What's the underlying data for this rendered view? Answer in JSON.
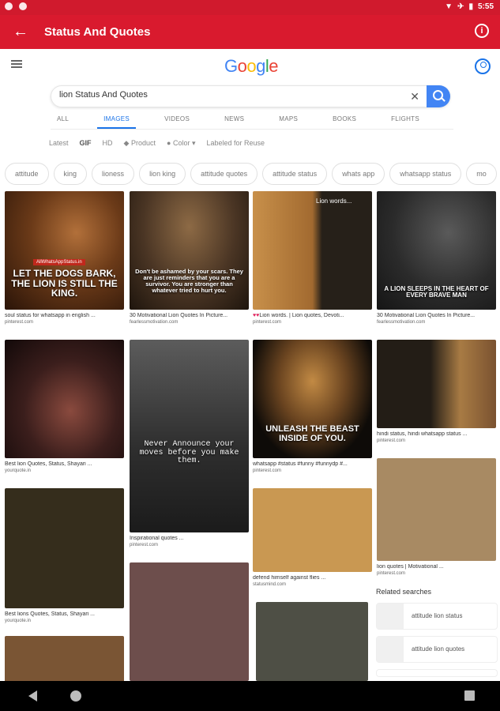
{
  "status_bar": {
    "time": "5:55"
  },
  "app_bar": {
    "title": "Status And Quotes"
  },
  "google": {
    "logo_letters": [
      "G",
      "o",
      "o",
      "g",
      "l",
      "e"
    ]
  },
  "search": {
    "query": "lion Status And Quotes"
  },
  "tabs": [
    "ALL",
    "IMAGES",
    "VIDEOS",
    "NEWS",
    "MAPS",
    "BOOKS",
    "FLIGHTS"
  ],
  "tools": [
    "Latest",
    "GIF",
    "HD",
    "Product",
    "Color",
    "Labeled for Reuse"
  ],
  "chips": [
    "attitude",
    "king",
    "lioness",
    "lion king",
    "attitude quotes",
    "attitude status",
    "whats app",
    "whatsapp status",
    "mo"
  ],
  "results": [
    {
      "caption": "soul status for whatsapp in english ...",
      "source": "pinterest.com",
      "overlay": "LET THE DOGS BARK, THE LION IS STILL THE KING.",
      "banner": "AllWhatsAppStatus.in"
    },
    {
      "caption": "30 Motivational Lion Quotes In Picture...",
      "source": "fearlessmotivation.com",
      "overlay": "Don't be ashamed by your scars. They are just reminders that you are a survivor. You are stronger than whatever tried to hurt you."
    },
    {
      "caption": "Lion words. | Lion quotes, Devoti...",
      "source": "pinterest.com",
      "overlay": "Lion words..."
    },
    {
      "caption": "30 Motivational Lion Quotes In Picture...",
      "source": "fearlessmotivation.com",
      "overlay": "A LION SLEEPS IN THE HEART OF EVERY BRAVE MAN"
    },
    {
      "caption": "Best lion Quotes, Status, Shayari ...",
      "source": "yourquote.in"
    },
    {
      "caption": "Inspirational quotes ...",
      "source": "pinterest.com",
      "overlay": "Never Announce your moves before you make them."
    },
    {
      "caption": "whatsapp #status #funny #funnydp #...",
      "source": "pinterest.com",
      "overlay": "UNLEASH THE BEAST INSIDE OF YOU."
    },
    {
      "caption": "hindi status, hindi whatsapp status ...",
      "source": "pinterest.com"
    },
    {
      "caption": "Best lions Quotes, Status, Shayari ...",
      "source": "yourquote.in"
    },
    {
      "caption": "defend himself against flies ...",
      "source": "statusmind.com"
    },
    {
      "caption": "lion quotes | Motivational ...",
      "source": "pinterest.com"
    }
  ],
  "related": {
    "heading": "Related searches",
    "items": [
      "attitude lion status",
      "attitude lion quotes"
    ]
  }
}
